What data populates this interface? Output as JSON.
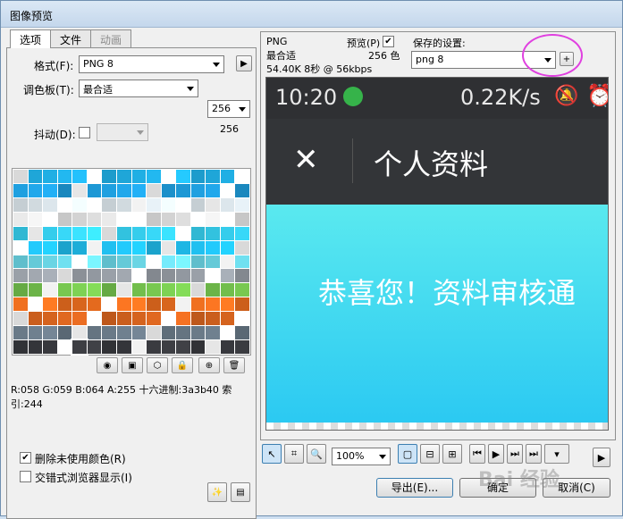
{
  "window": {
    "title": "图像预览"
  },
  "tabs": [
    {
      "label": "选项"
    },
    {
      "label": "文件"
    },
    {
      "label": "动画"
    }
  ],
  "options": {
    "format_label": "格式(F):",
    "format_value": "PNG 8",
    "palette_label": "调色板(T):",
    "palette_value": "最合适",
    "colors_value": "256",
    "colors_count": "256",
    "dither_label": "抖动(D):",
    "color_info": "R:058 G:059 B:064 A:255 十六进制:3a3b40 索引:244",
    "remove_unused_label": "删除未使用颜色(R)",
    "interlaced_label": "交错式浏览器显示(I)"
  },
  "preview": {
    "format": "PNG",
    "palette": "最合适",
    "size_info": "54.40K  8秒 @ 56kbps",
    "preview_label": "预览(P)",
    "colors_text": "256 色",
    "saved_settings_label": "保存的设置:",
    "saved_settings_value": "png 8"
  },
  "phone": {
    "time": "10:20",
    "speed": "0.22K/s",
    "close_glyph": "✕",
    "page_title": "个人资料",
    "message": "恭喜您！资料审核通"
  },
  "toolbar": {
    "zoom_value": "100%"
  },
  "buttons": {
    "export": "导出(E)...",
    "ok": "确定",
    "cancel": "取消(C)"
  },
  "watermark": "Bai  经验",
  "colors": {
    "accent": "#e040e0"
  }
}
